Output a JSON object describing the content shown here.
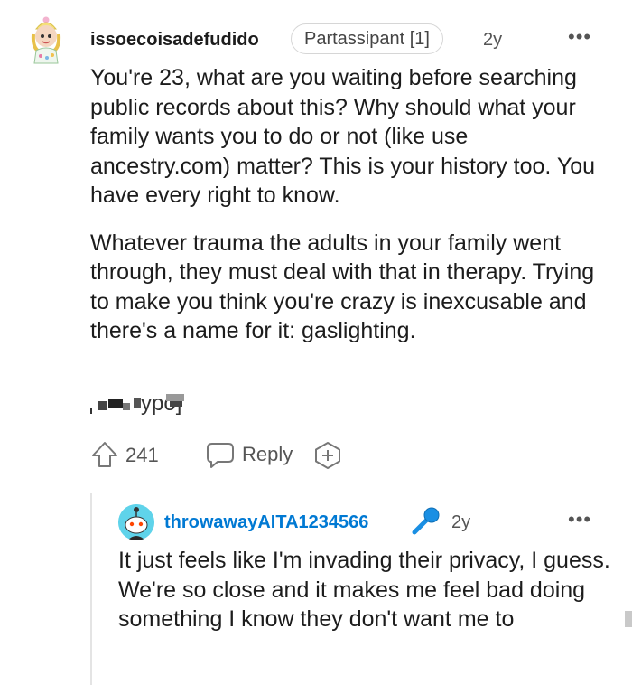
{
  "comment": {
    "username": "issoecoisadefudido",
    "flair": "Partassipant [1]",
    "age": "2y",
    "more_label": "•••",
    "paragraphs": [
      "You're 23, what are you waiting before searching public records about this? Why should what your family wants you to do or not (like use ancestry.com) matter? This is your history too. You have every right to know.",
      "Whatever trauma the adults in your family went through, they must deal with that in therapy. Trying to make you think you're crazy is inexcusable and there's a name for it: gaslighting."
    ],
    "score": "241",
    "reply_label": "Reply"
  },
  "reply": {
    "username": "throwawayAITA1234566",
    "age": "2y",
    "more_label": "•••",
    "body": "It just feels like I'm invading their privacy, I guess. We're so close and it makes me feel bad doing something I know they don't want me to"
  },
  "colors": {
    "username_link": "#0079d3",
    "avatar_bg": "#5fd3ea",
    "mic_accent": "#1a8fe3"
  }
}
